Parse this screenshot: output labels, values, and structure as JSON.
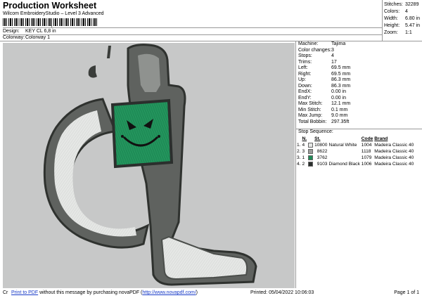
{
  "header": {
    "title": "Production Worksheet",
    "subtitle": "Wilcom EmbroideryStudio – Level 3 Advanced",
    "barcode_text": "1",
    "design_label": "Design:",
    "design_value": "KEY CL 6,8 in",
    "colorway_label": "Colorway:",
    "colorway_value": "Colorway 1"
  },
  "stats": [
    {
      "label": "Stitches:",
      "value": "32289"
    },
    {
      "label": "Colors:",
      "value": "4"
    },
    {
      "label": "Width:",
      "value": "6.80 in"
    },
    {
      "label": "Height:",
      "value": "5.47 in"
    },
    {
      "label": "Zoom:",
      "value": "1:1"
    }
  ],
  "specs": [
    {
      "label": "Machine:",
      "value": "Tajima"
    },
    {
      "label": "Color changes:",
      "value": "3"
    },
    {
      "label": "Stops:",
      "value": "4"
    },
    {
      "label": "Trims:",
      "value": "17"
    },
    {
      "label": "Left:",
      "value": "69.5 mm"
    },
    {
      "label": "Right:",
      "value": "69.5 mm"
    },
    {
      "label": "Up:",
      "value": "86.3 mm"
    },
    {
      "label": "Down:",
      "value": "86.3 mm"
    },
    {
      "label": "EndX:",
      "value": "0.00 in"
    },
    {
      "label": "EndY:",
      "value": "0.00 in"
    },
    {
      "label": "Max Stitch:",
      "value": "12.1 mm"
    },
    {
      "label": "Min Stitch:",
      "value": "0.1 mm"
    },
    {
      "label": "Max Jump:",
      "value": "9.0 mm"
    },
    {
      "label": "Total Bobbin:",
      "value": "297.35ft"
    }
  ],
  "stop_sequence": {
    "title": "Stop Sequence:",
    "headers": {
      "n": "N.",
      "st": "St.",
      "code": "Code",
      "brand": "Brand"
    },
    "rows": [
      {
        "stop": "1.",
        "n": "4",
        "st": "10800",
        "name": "Natural White",
        "code": "1004",
        "brand": "Madeira Classic 40",
        "color": "#e6e8e6"
      },
      {
        "stop": "2.",
        "n": "3",
        "st": "8622",
        "name": "",
        "code": "1118",
        "brand": "Madeira Classic 40",
        "color": "#9a9c9a"
      },
      {
        "stop": "3.",
        "n": "1",
        "st": "3762",
        "name": "",
        "code": "1079",
        "brand": "Madeira Classic 40",
        "color": "#1f8c57"
      },
      {
        "stop": "4.",
        "n": "2",
        "st": "9103",
        "name": "Diamond Black",
        "code": "1006",
        "brand": "Madeira Classic 40",
        "color": "#2b2f2d"
      }
    ]
  },
  "footer": {
    "prefix": "Cr",
    "link": "Print to PDF",
    "message": "without this message by purchasing novaPDF (",
    "url": "http://www.novapdf.com/",
    "close": ")",
    "printed": "Printed: 05/04/2022 10:06:03",
    "page": "Page 1 of 1"
  }
}
